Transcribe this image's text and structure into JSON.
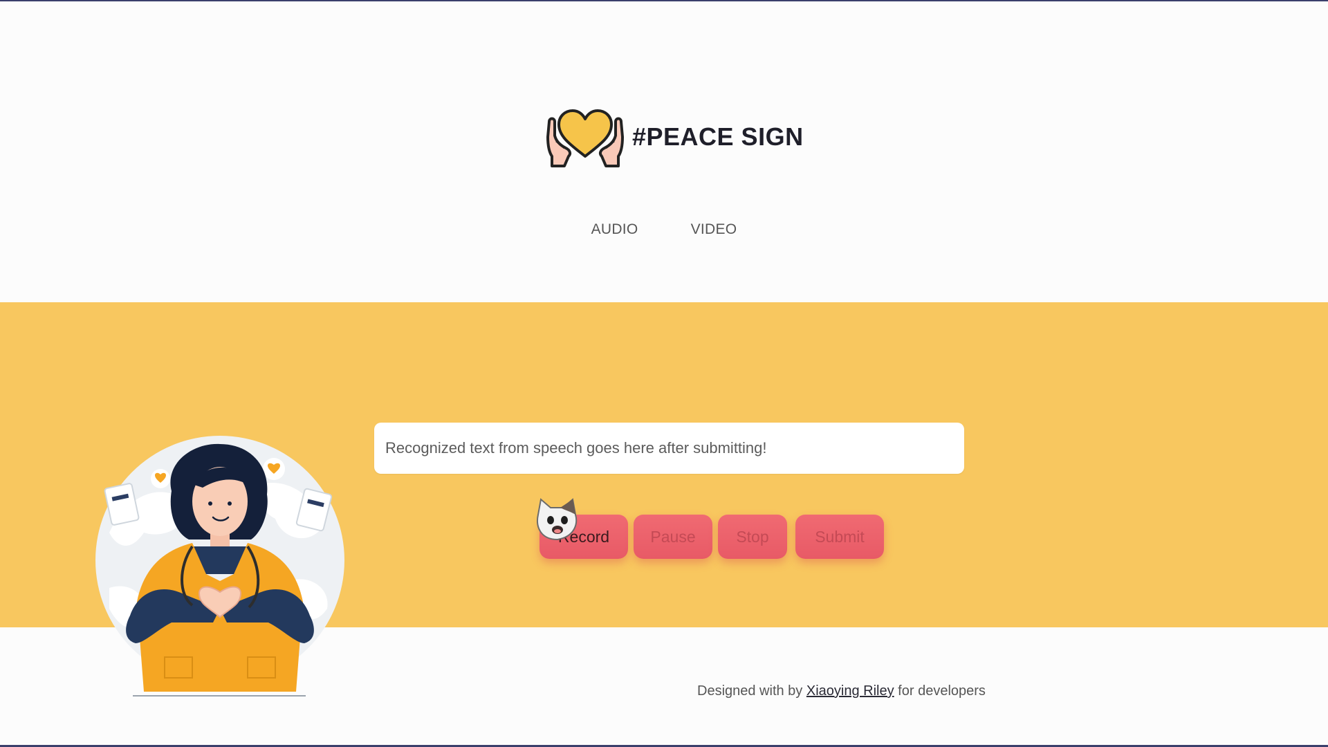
{
  "header": {
    "title": "#PEACE SIGN",
    "logo_icon": "heart-hands-icon"
  },
  "nav": {
    "items": [
      {
        "label": "AUDIO"
      },
      {
        "label": "VIDEO"
      }
    ]
  },
  "main": {
    "transcript_placeholder": "Recognized text from speech goes here after submitting!",
    "buttons": {
      "record": "Record",
      "pause": "Pause",
      "stop": "Stop",
      "submit": "Submit"
    }
  },
  "footer": {
    "prefix": "Designed with by",
    "author": "Xiaoying Riley",
    "suffix": "for developers"
  },
  "colors": {
    "hero_background": "#f8c75f",
    "button": "#ec6470",
    "title": "#1f1f2a"
  }
}
